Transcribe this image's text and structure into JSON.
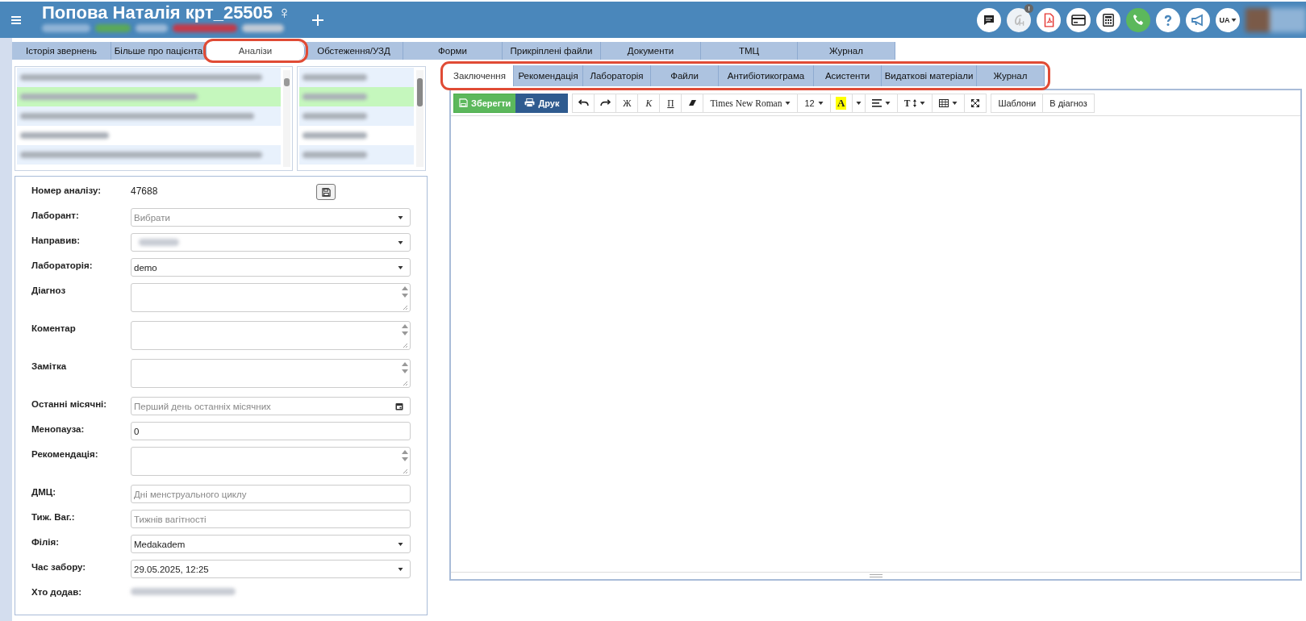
{
  "header": {
    "title": "Попова Наталія крт_25505 ♀",
    "notification_badge": "!",
    "language": "UA"
  },
  "main_tabs": [
    {
      "label": "Історія звернень",
      "selected": false,
      "highlighted": false
    },
    {
      "label": "Більше про пацієнта",
      "selected": false,
      "highlighted": false
    },
    {
      "label": "Аналізи",
      "selected": true,
      "highlighted": true
    },
    {
      "label": "Обстеження/УЗД",
      "selected": false,
      "highlighted": false
    },
    {
      "label": "Форми",
      "selected": false,
      "highlighted": false
    },
    {
      "label": "Прикріплені файли",
      "selected": false,
      "highlighted": false
    },
    {
      "label": "Документи",
      "selected": false,
      "highlighted": false
    },
    {
      "label": "ТМЦ",
      "selected": false,
      "highlighted": false
    },
    {
      "label": "Журнал",
      "selected": false,
      "highlighted": false
    }
  ],
  "analysis_list": [
    {
      "selected": false
    },
    {
      "selected": true
    },
    {
      "selected": false
    },
    {
      "selected": false
    },
    {
      "selected": false
    }
  ],
  "form": {
    "fields": [
      {
        "kind": "text",
        "label": "Номер аналізу:",
        "value": "47688"
      },
      {
        "kind": "select",
        "label": "Лаборант:",
        "placeholder": "Вибрати"
      },
      {
        "kind": "redacted-select",
        "label": "Направив:"
      },
      {
        "kind": "select",
        "label": "Лабораторія:",
        "value": "demo"
      },
      {
        "kind": "textarea",
        "label": "Діагноз"
      },
      {
        "kind": "textarea",
        "label": "Коментар"
      },
      {
        "kind": "textarea",
        "label": "Замітка"
      },
      {
        "kind": "date",
        "label": "Останні місячні:",
        "placeholder": "Перший день останніх місячних"
      },
      {
        "kind": "input",
        "label": "Менопауза:",
        "value": "0"
      },
      {
        "kind": "textarea",
        "label": "Рекомендація:"
      },
      {
        "kind": "input",
        "label": "ДМЦ:",
        "placeholder": "Дні менструального циклу"
      },
      {
        "kind": "input",
        "label": "Тиж. Ваг.:",
        "placeholder": "Тижнів вагітності"
      },
      {
        "kind": "select",
        "label": "Філія:",
        "value": "Medakadem"
      },
      {
        "kind": "select",
        "label": "Час забору:",
        "value": "29.05.2025, 12:25"
      },
      {
        "kind": "redacted",
        "label": "Хто додав:"
      }
    ]
  },
  "sub_tabs": {
    "highlighted": true,
    "items": [
      {
        "label": "Заключення",
        "selected": true
      },
      {
        "label": "Рекомендація",
        "selected": false
      },
      {
        "label": "Лабораторія",
        "selected": false
      },
      {
        "label": "Файли",
        "selected": false
      },
      {
        "label": "Антибіотикограма",
        "selected": false
      },
      {
        "label": "Асистенти",
        "selected": false
      },
      {
        "label": "Видаткові матеріали",
        "selected": false
      },
      {
        "label": "Журнал",
        "selected": false
      }
    ]
  },
  "editor_toolbar": {
    "save": "Зберегти",
    "print": "Друк",
    "bold": "Ж",
    "italic": "К",
    "underline": "П",
    "font": "Times New Roman",
    "size": "12",
    "color_letter": "A",
    "text_size": "T",
    "templates": "Шаблони",
    "to_diagnosis": "В діагноз"
  }
}
